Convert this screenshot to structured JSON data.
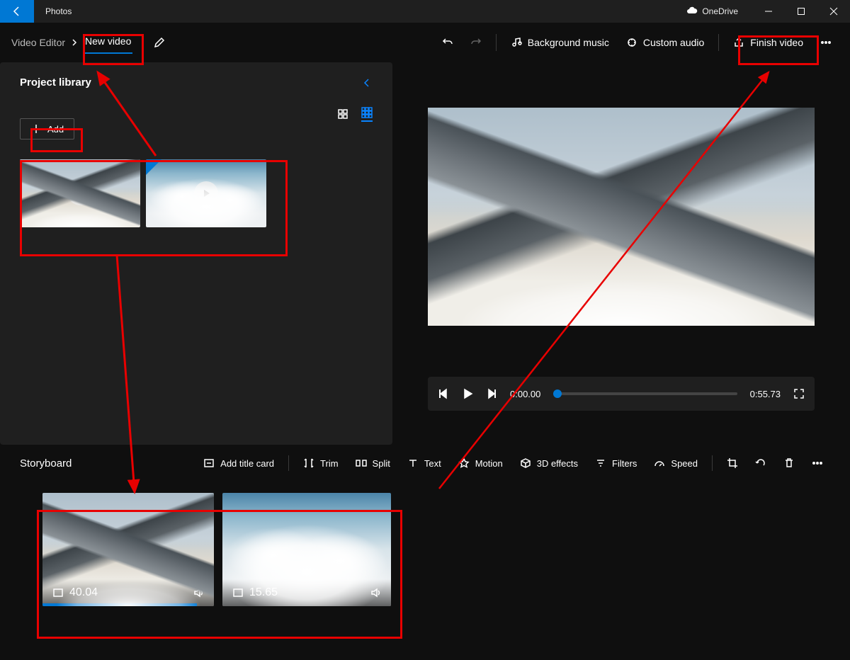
{
  "titlebar": {
    "app_name": "Photos",
    "onedrive_label": "OneDrive"
  },
  "breadcrumb": {
    "root": "Video Editor",
    "current": "New video"
  },
  "toolbar": {
    "bg_music": "Background music",
    "custom_audio": "Custom audio",
    "finish": "Finish video"
  },
  "library": {
    "title": "Project library",
    "add_label": "Add"
  },
  "player": {
    "current": "0:00.00",
    "total": "0:55.73"
  },
  "storyboard": {
    "title": "Storyboard",
    "add_title_card": "Add title card",
    "trim": "Trim",
    "split": "Split",
    "text": "Text",
    "motion": "Motion",
    "effects3d": "3D effects",
    "filters": "Filters",
    "speed": "Speed",
    "clips": [
      {
        "duration": "40.04"
      },
      {
        "duration": "15.65"
      }
    ]
  }
}
